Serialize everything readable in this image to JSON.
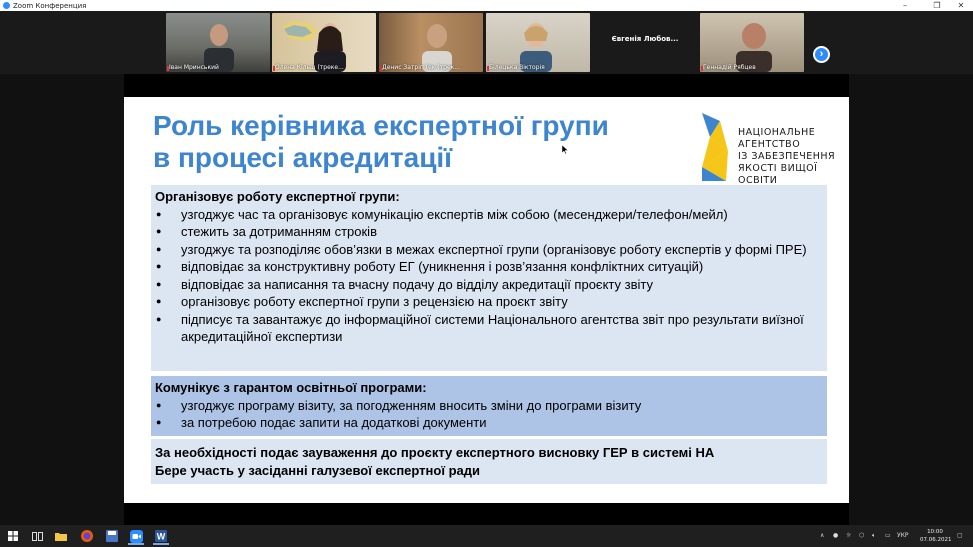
{
  "window": {
    "title": "Zoom Конференция",
    "minimize": "–",
    "maximize": "❐",
    "close": "✕"
  },
  "participants": [
    {
      "name": "Іван Мринський",
      "muted": true
    },
    {
      "name": "Олена Кільш (треке...",
      "muted": true
    },
    {
      "name": "Денис Затріп (ек (трек...",
      "muted": true
    },
    {
      "name": "Білецька Вікторія",
      "muted": true
    },
    {
      "name": "Євгенія Любов...",
      "muted": false
    },
    {
      "name": "Геннадій Рябцев",
      "muted": true
    }
  ],
  "next_page_icon": "›",
  "slide": {
    "title_line1": "Роль керівника експертної групи",
    "title_line2": "в процесі акредитації",
    "agency_line1": "Національне",
    "agency_line2": "агентство",
    "agency_line3": "із забезпечення",
    "agency_line4": "якості вищої освіти",
    "section1": {
      "header": "Організовує роботу експертної групи:",
      "items": [
        "узгоджує час та організовує комунікацію експертів між собою (месенджери/телефон/мейл)",
        "стежить за дотриманням строків",
        "узгоджує та розподіляє обов’язки в межах експертної групи (організовує роботу експертів у формі ПРЕ)",
        "відповідає за конструктивну роботу ЕГ (уникнення і розв’язання конфліктних ситуацій)",
        "відповідає за написання та вчасну подачу до відділу акредитації проєкту звіту",
        "організовує роботу експертної групи з рецензією на проєкт звіту",
        "підписує та завантажує до інформаційної  системи Національного агентства звіт про результати виїзної акредитаційної експертизи"
      ]
    },
    "section2": {
      "header": "Комунікує з гарантом освітньої програми:",
      "items": [
        "узгоджує програму візиту, за погодженням вносить зміни до програми візиту",
        "за потребою подає запити на додаткові документи"
      ]
    },
    "section3": {
      "line1": "За необхідності подає зауваження до проєкту експертного висновку ГЕР в системі НА",
      "line2": "Бере участь у засіданні галузевої експертної ради"
    }
  },
  "taskbar": {
    "language": "УКР",
    "time": "10:00",
    "date": "07.06.2021"
  },
  "colors": {
    "title_blue": "#3d85cf",
    "box_light": "#dce5f2",
    "box_mid": "#adc4e6",
    "logo_yellow": "#f5c518",
    "logo_blue": "#3d85cf",
    "zoom_blue": "#2d8cff"
  }
}
